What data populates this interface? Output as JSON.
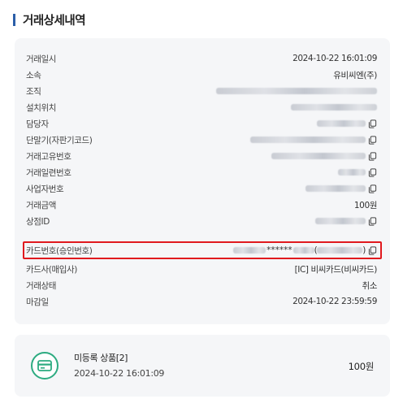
{
  "header": {
    "title": "거래상세내역"
  },
  "details": {
    "date": {
      "label": "거래일시",
      "value": "2024-10-22 16:01:09"
    },
    "affiliation": {
      "label": "소속",
      "value": "유비씨엔(주)"
    },
    "org": {
      "label": "조직"
    },
    "location": {
      "label": "설치위치"
    },
    "manager": {
      "label": "담당자"
    },
    "terminal": {
      "label": "단말기(자판기코드)"
    },
    "txn_id": {
      "label": "거래고유번호"
    },
    "serial": {
      "label": "거래일련번호"
    },
    "biz_no": {
      "label": "사업자번호"
    },
    "amount": {
      "label": "거래금액",
      "value": "100원"
    },
    "store_id": {
      "label": "상점ID"
    },
    "card_no": {
      "label": "카드번호(승인번호)",
      "masked": "******",
      "open_paren": "(",
      "close_paren": ")"
    },
    "card_co": {
      "label": "카드사(매입사)",
      "value": "[IC] 비씨카드(비씨카드)"
    },
    "status": {
      "label": "거래상태",
      "value": "취소"
    },
    "closing": {
      "label": "마감일",
      "value": "2024-10-22 23:59:59"
    }
  },
  "product": {
    "name": "미등록 상품[2]",
    "date": "2024-10-22 16:01:09",
    "amount": "100원"
  },
  "colors": {
    "accent": "#2b5ea8",
    "highlight": "#e0191e",
    "product_icon": "#2dab81"
  }
}
